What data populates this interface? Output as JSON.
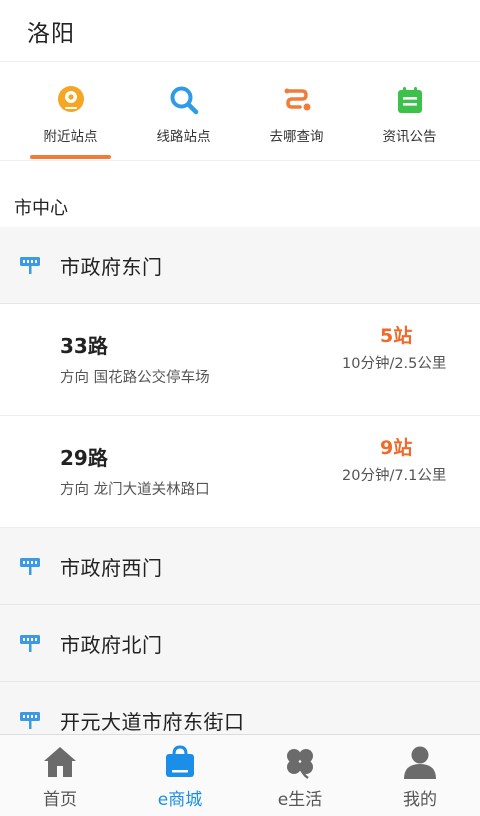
{
  "header": {
    "city": "洛阳"
  },
  "nav": {
    "items": [
      {
        "label": "附近站点",
        "icon": "location-pin-icon",
        "color": "#f5a623"
      },
      {
        "label": "线路站点",
        "icon": "search-icon",
        "color": "#2f9be8"
      },
      {
        "label": "去哪查询",
        "icon": "route-icon",
        "color": "#f07c3a"
      },
      {
        "label": "资讯公告",
        "icon": "notice-icon",
        "color": "#3cc24a"
      }
    ],
    "active_index": 0,
    "accent": "#f07c3a"
  },
  "area": {
    "label": "市中心"
  },
  "stations": [
    {
      "name": "市政府东门",
      "routes": [
        {
          "name": "33路",
          "direction": "方向 国花路公交停车场",
          "stops": "5站",
          "eta": "10分钟/2.5公里"
        },
        {
          "name": "29路",
          "direction": "方向 龙门大道关林路口",
          "stops": "9站",
          "eta": "20分钟/7.1公里"
        }
      ]
    },
    {
      "name": "市政府西门"
    },
    {
      "name": "市政府北门"
    },
    {
      "name": "开元大道市府东街口"
    }
  ],
  "tabbar": {
    "items": [
      {
        "label": "首页",
        "icon": "home-icon"
      },
      {
        "label": "e商城",
        "icon": "shopping-bag-icon"
      },
      {
        "label": "e生活",
        "icon": "clover-icon"
      },
      {
        "label": "我的",
        "icon": "user-icon"
      }
    ],
    "active_index": 1,
    "active_color": "#1b8ee8"
  }
}
